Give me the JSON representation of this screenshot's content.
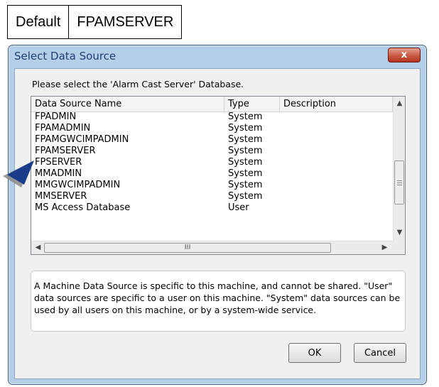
{
  "header_table": [
    "Default",
    "FPAMSERVER"
  ],
  "dialog": {
    "title": "Select Data Source",
    "close_glyph": "x",
    "prompt": "Please select the 'Alarm Cast Server' Database.",
    "columns": [
      "Data Source Name",
      "Type",
      "Description"
    ],
    "rows": [
      {
        "name": "FPADMIN",
        "type": "System"
      },
      {
        "name": "FPAMADMIN",
        "type": "System"
      },
      {
        "name": "FPAMGWCIMPADMIN",
        "type": "System"
      },
      {
        "name": "FPAMSERVER",
        "type": "System"
      },
      {
        "name": "FPSERVER",
        "type": "System"
      },
      {
        "name": "MMADMIN",
        "type": "System"
      },
      {
        "name": "MMGWCIMPADMIN",
        "type": "System"
      },
      {
        "name": "MMSERVER",
        "type": "System"
      },
      {
        "name": "MS Access Database",
        "type": "User"
      }
    ],
    "scrollbar_grip": "III",
    "info_text": "A Machine Data Source is specific to this machine, and cannot be shared. \"User\" data sources are specific to a user on this machine.  \"System\" data sources can be used by all users on this machine, or by a system-wide service.",
    "ok_label": "OK",
    "cancel_label": "Cancel"
  },
  "annotation": {
    "pointer_icon": "arrow-pointer-icon",
    "color": "#1a3a8a"
  }
}
